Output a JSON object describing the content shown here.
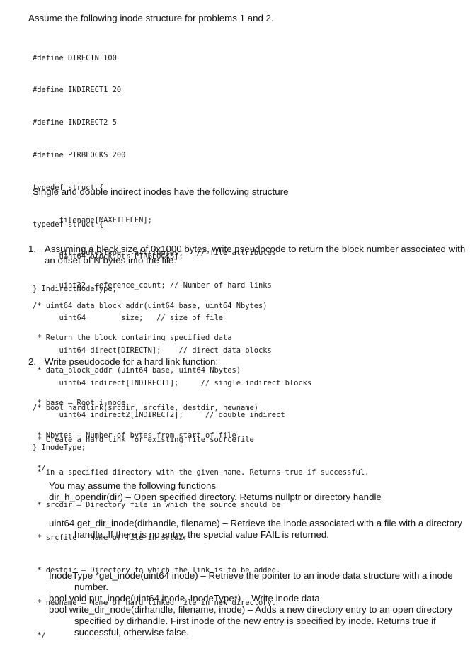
{
  "intro": "Assume the following inode structure for problems 1 and 2.",
  "inode_code": [
    "#define DIRECTN 100",
    "#define INDIRECT1 20",
    "#define INDIRECT2 5",
    "#define PTRBLOCKS 200",
    "typedef struct {",
    "      filename[MAXFILELEN];",
    "      attributesType   attributes;   // file attributes",
    "      uint32  reference_count; // Number of hard links",
    "      uint64        size;   // size of file",
    "      uint64 direct[DIRECTN];    // direct data blocks",
    "      uint64 indirect[INDIRECT1];     // single indirect blocks",
    "      uint64 indirect2[INDIRECT2];     // double indirect",
    "} InodeType;"
  ],
  "indirect_intro": "Single and double indirect inodes have the following structure",
  "indirect_code": [
    "typedef struct {",
    "      uint64 block_ptr[PTRBLOCKS];",
    "} IndirectNodeType;"
  ],
  "questions": [
    {
      "number": "1.",
      "text": "Assuming a block size of 0x1000 bytes, write pseudocode to return the block number associated with an offset of N bytes into the file:",
      "code": [
        "/* uint64 data_block_addr(uint64 base, uint64 Nbytes)",
        " * Return the block containing specified data",
        " * data_block_addr (uint64 base, uint64 Nbytes)",
        " * base – Root i-node",
        " * Nbytes – Number of bytes from start of file",
        " */"
      ]
    },
    {
      "number": "2.",
      "text": "Write pseudocode for a hard link function:",
      "code": [
        "/* bool hardlink(srcdir, srcfile, destdir, newname)",
        " * Create a hard link for existing file sourcefile",
        " * in a specified directory with the given name. Returns true if successful.",
        " * srcdir – Directory file in which the source should be",
        " * srcfile – Name of file in srcdir",
        " * destdir – Directory to which the link is to be added.",
        " * newname – Name of hard linked file in new directory.",
        " */"
      ]
    }
  ],
  "functions": {
    "heading": "You may assume the following functions",
    "items": [
      "dir_h_opendir(dir) – Open specified directory. Returns nullptr or directory handle",
      "uint64 get_dir_inode(dirhandle, filename) – Retrieve the inode associated with a file with a directory handle. If there is no entry, the special value FAIL is returned.",
      "InodeType *get_inode(uint64 inode) – Retrieve the pointer to an inode data structure with a inode number.",
      "bool void put_inode(uint64 inode, InodeType*) – Write inode data",
      "bool write_dir_node(dirhandle, filename, inode) – Adds a new directory entry to an open directory specified by dirhandle. First inode of the new entry is specified by inode. Returns true if successful, otherwise false."
    ]
  }
}
